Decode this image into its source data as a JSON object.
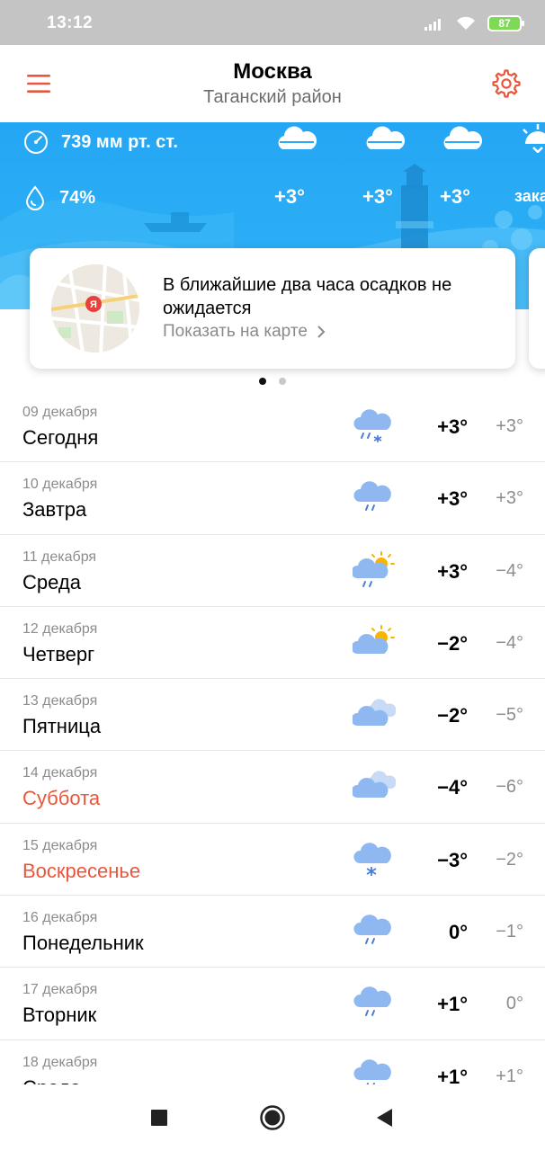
{
  "status_bar": {
    "time": "13:12",
    "battery": "87"
  },
  "header": {
    "city": "Москва",
    "district": "Таганский район"
  },
  "current": {
    "pressure": "739 мм рт. ст.",
    "humidity": "74%"
  },
  "hourly": [
    {
      "temp": "+3°",
      "icon": "cloud-icon"
    },
    {
      "temp": "+3°",
      "icon": "cloud-icon"
    },
    {
      "temp": "+3°",
      "icon": "cloud-icon"
    },
    {
      "temp": "зака",
      "icon": "sunset-icon"
    }
  ],
  "nowcast": {
    "text": "В ближайшие два часа осадков не ожидается",
    "link": "Показать на карте",
    "map_badge": "Я"
  },
  "forecast": [
    {
      "date": "09 декабря",
      "day": "Сегодня",
      "max": "+3°",
      "min": "+3°",
      "weekend": false,
      "icon": "rain-snow-icon"
    },
    {
      "date": "10 декабря",
      "day": "Завтра",
      "max": "+3°",
      "min": "+3°",
      "weekend": false,
      "icon": "rain-icon"
    },
    {
      "date": "11 декабря",
      "day": "Среда",
      "max": "+3°",
      "min": "−4°",
      "weekend": false,
      "icon": "sun-rain-icon"
    },
    {
      "date": "12 декабря",
      "day": "Четверг",
      "max": "−2°",
      "min": "−4°",
      "weekend": false,
      "icon": "partly-sunny-icon"
    },
    {
      "date": "13 декабря",
      "day": "Пятница",
      "max": "−2°",
      "min": "−5°",
      "weekend": false,
      "icon": "cloudy-icon"
    },
    {
      "date": "14 декабря",
      "day": "Суббота",
      "max": "−4°",
      "min": "−6°",
      "weekend": true,
      "icon": "cloudy-icon"
    },
    {
      "date": "15 декабря",
      "day": "Воскресенье",
      "max": "−3°",
      "min": "−2°",
      "weekend": true,
      "icon": "snow-icon"
    },
    {
      "date": "16 декабря",
      "day": "Понедельник",
      "max": "0°",
      "min": "−1°",
      "weekend": false,
      "icon": "rain-icon"
    },
    {
      "date": "17 декабря",
      "day": "Вторник",
      "max": "+1°",
      "min": "0°",
      "weekend": false,
      "icon": "rain-icon"
    },
    {
      "date": "18 декабря",
      "day": "Среда",
      "max": "+1°",
      "min": "+1°",
      "weekend": false,
      "icon": "rain-icon"
    }
  ],
  "colors": {
    "accent": "#e8573c",
    "sky": "#2aabf5",
    "weekend": "#e8573c",
    "icon_cloud": "#8fb8f0",
    "icon_sun": "#f7b500"
  }
}
